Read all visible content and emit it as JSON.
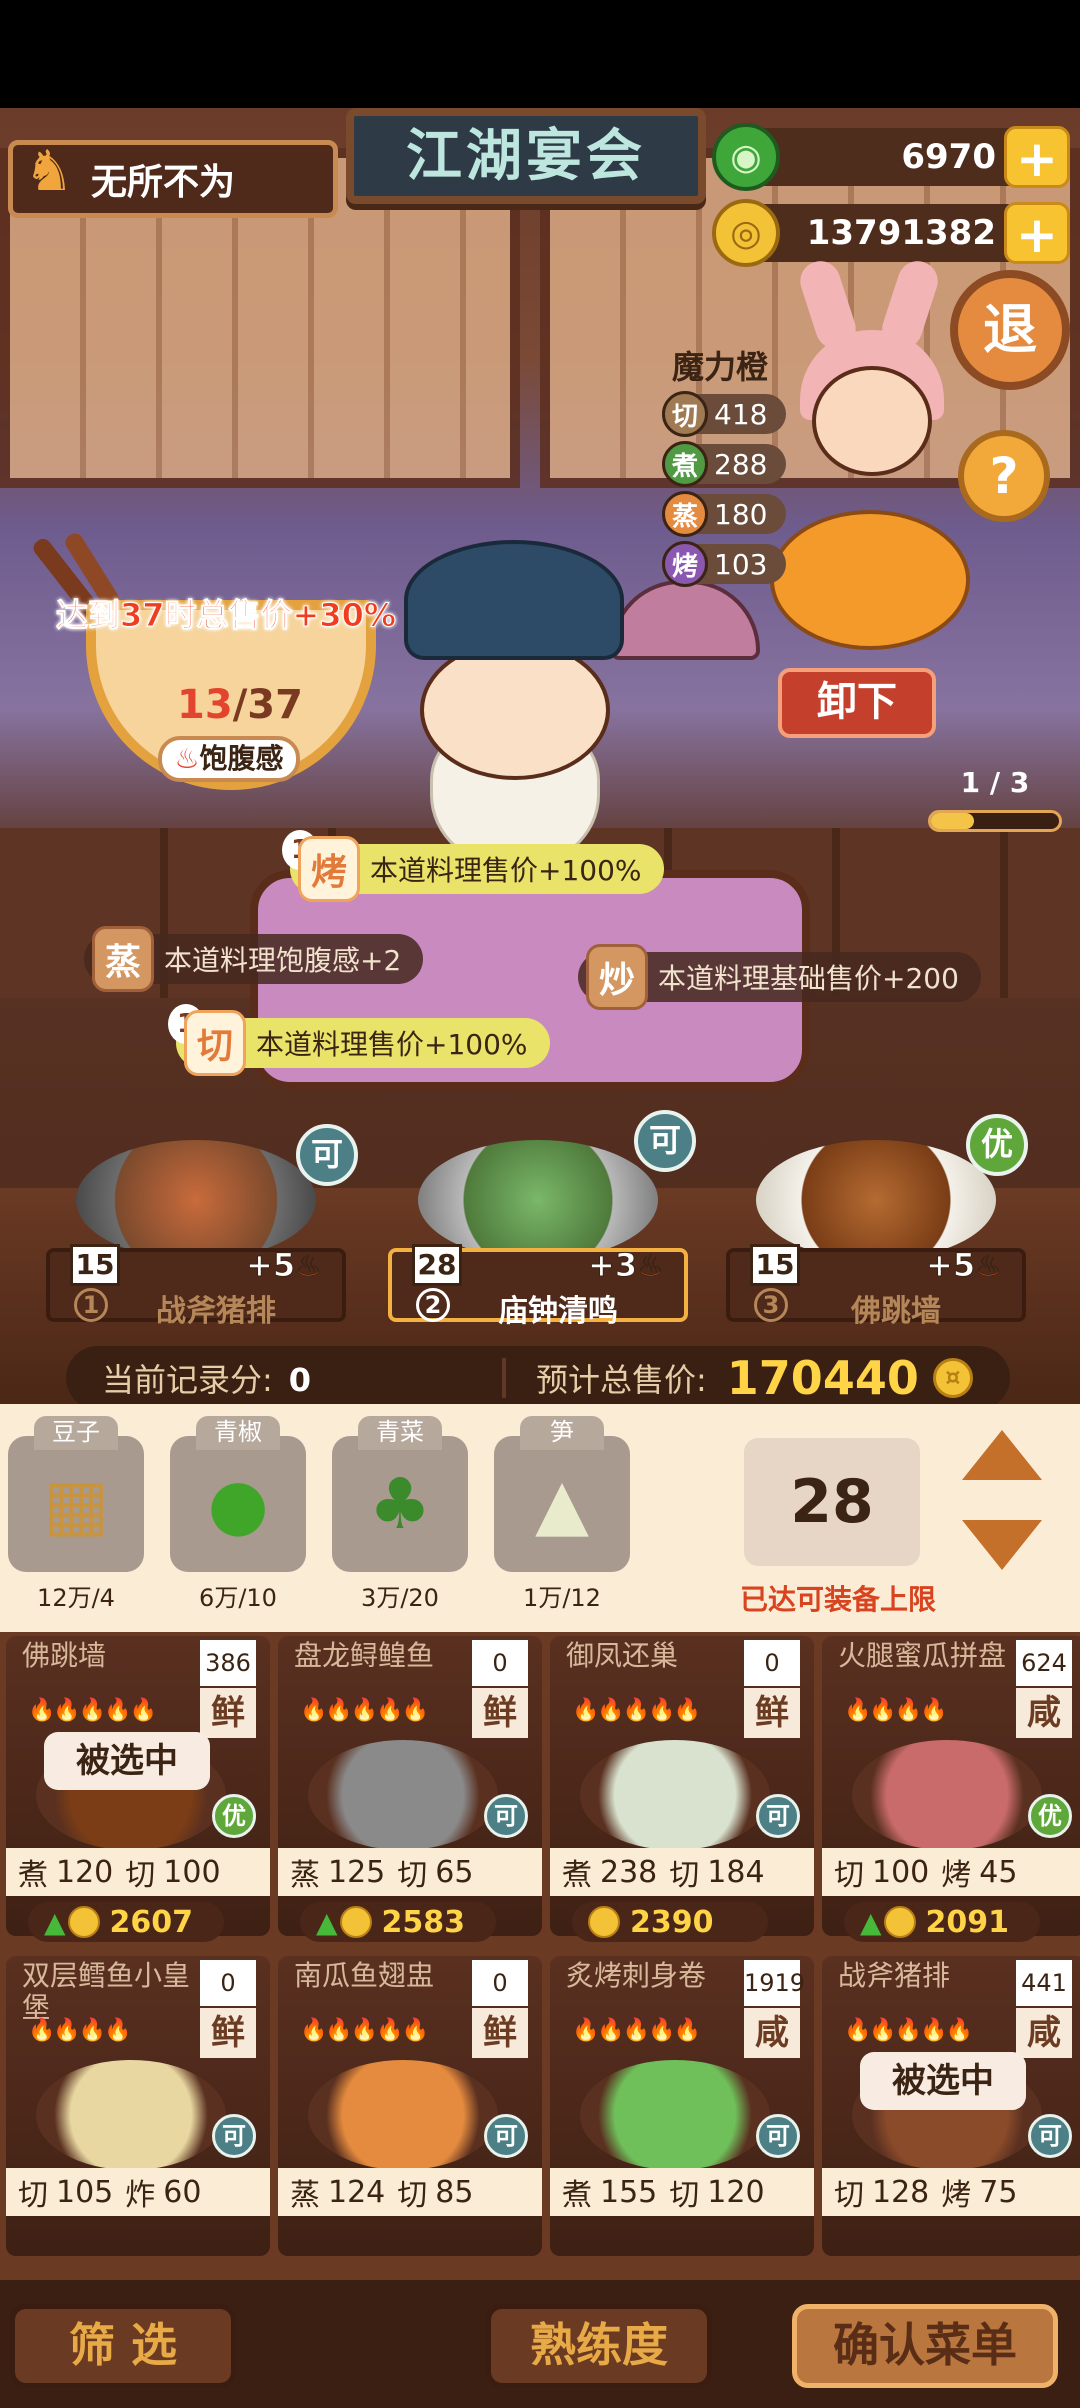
{
  "header": {
    "player_name": "无所不为",
    "logo_text": "江湖宴会",
    "jade": {
      "value": "6970",
      "plus": "+"
    },
    "coins": {
      "value": "13791382",
      "plus": "+"
    },
    "exit_label": "退",
    "help_label": "?"
  },
  "chef": {
    "name": "魔力橙",
    "stats": [
      {
        "label": "切",
        "value": "418",
        "color": "#a07a52"
      },
      {
        "label": "煮",
        "value": "288",
        "color": "#4f9a43"
      },
      {
        "label": "蒸",
        "value": "180",
        "color": "#e58b3f"
      },
      {
        "label": "烤",
        "value": "103",
        "color": "#8a58b0"
      }
    ],
    "unload_label": "卸下",
    "page": "1 / 3",
    "page_fraction": 0.333
  },
  "satiety": {
    "bonus_text": "达到37时总售价+30%",
    "current": "13",
    "sep_max": "/37",
    "label": "饱腹感",
    "fraction": 0.351
  },
  "skills": [
    {
      "level": "1",
      "icon": "烤",
      "text": "本道料理售价+100%",
      "active": true
    },
    {
      "level": "",
      "icon": "蒸",
      "text": "本道料理饱腹感+2",
      "active": false
    },
    {
      "level": "",
      "icon": "炒",
      "text": "本道料理基础售价+200",
      "active": false
    },
    {
      "level": "1",
      "icon": "切",
      "text": "本道料理售价+100%",
      "active": true
    }
  ],
  "slots": [
    {
      "index": "1",
      "name": "战斧猪排",
      "qty": "15",
      "bonus": "+5",
      "rank": "可"
    },
    {
      "index": "2",
      "name": "庙钟清鸣",
      "qty": "28",
      "bonus": "+3",
      "rank": "可"
    },
    {
      "index": "3",
      "name": "佛跳墙",
      "qty": "15",
      "bonus": "+5",
      "rank": "优"
    }
  ],
  "score": {
    "record_label": "当前记录分:",
    "record_value": "0",
    "total_label": "预计总售价:",
    "total_value": "170440"
  },
  "ingredients": [
    {
      "name": "豆子",
      "count": "12万/4",
      "icon": "tofu-box-icon",
      "glyph": "▦"
    },
    {
      "name": "青椒",
      "count": "6万/10",
      "icon": "green-pepper-icon",
      "glyph": "●"
    },
    {
      "name": "青菜",
      "count": "3万/20",
      "icon": "greens-icon",
      "glyph": "♣"
    },
    {
      "name": "笋",
      "count": "1万/12",
      "icon": "bamboo-shoot-icon",
      "glyph": "▲"
    }
  ],
  "portion": {
    "value": "28",
    "message": "已达可装备上限"
  },
  "recipes": [
    {
      "title": "佛跳墙",
      "stock": "386",
      "taste": "鲜",
      "stars": "🔥🔥🔥🔥🔥",
      "selected": "被选中",
      "rank": "优",
      "skill1": "煮",
      "val1": "120",
      "skill2": "切",
      "val2": "100",
      "price": "2607",
      "up": true
    },
    {
      "title": "盘龙鲟鳇鱼",
      "stock": "0",
      "taste": "鲜",
      "stars": "🔥🔥🔥🔥🔥",
      "selected": "",
      "rank": "可",
      "skill1": "蒸",
      "val1": "125",
      "skill2": "切",
      "val2": "65",
      "price": "2583",
      "up": true
    },
    {
      "title": "御凤还巢",
      "stock": "0",
      "taste": "鲜",
      "stars": "🔥🔥🔥🔥🔥",
      "selected": "",
      "rank": "可",
      "skill1": "煮",
      "val1": "238",
      "skill2": "切",
      "val2": "184",
      "price": "2390",
      "up": false
    },
    {
      "title": "火腿蜜瓜拼盘",
      "stock": "624",
      "taste": "咸",
      "stars": "🔥🔥🔥🔥",
      "selected": "",
      "rank": "优",
      "skill1": "切",
      "val1": "100",
      "skill2": "烤",
      "val2": "45",
      "price": "2091",
      "up": true
    },
    {
      "title": "双层鳕鱼小皇堡",
      "stock": "0",
      "taste": "鲜",
      "stars": "🔥🔥🔥🔥",
      "selected": "",
      "rank": "可",
      "skill1": "切",
      "val1": "105",
      "skill2": "炸",
      "val2": "60",
      "price": "",
      "up": false
    },
    {
      "title": "南瓜鱼翅盅",
      "stock": "0",
      "taste": "鲜",
      "stars": "🔥🔥🔥🔥🔥",
      "selected": "",
      "rank": "可",
      "skill1": "蒸",
      "val1": "124",
      "skill2": "切",
      "val2": "85",
      "price": "",
      "up": false
    },
    {
      "title": "炙烤刺身卷",
      "stock": "1919",
      "taste": "咸",
      "stars": "🔥🔥🔥🔥🔥",
      "selected": "",
      "rank": "可",
      "skill1": "煮",
      "val1": "155",
      "skill2": "切",
      "val2": "120",
      "price": "",
      "up": false
    },
    {
      "title": "战斧猪排",
      "stock": "441",
      "taste": "咸",
      "stars": "🔥🔥🔥🔥🔥",
      "selected": "被选中",
      "rank": "可",
      "skill1": "切",
      "val1": "128",
      "skill2": "烤",
      "val2": "75",
      "price": "",
      "up": false
    }
  ],
  "bottom": {
    "filter_label": "筛  选",
    "proficiency_label": "熟练度",
    "confirm_label": "确认菜单"
  }
}
